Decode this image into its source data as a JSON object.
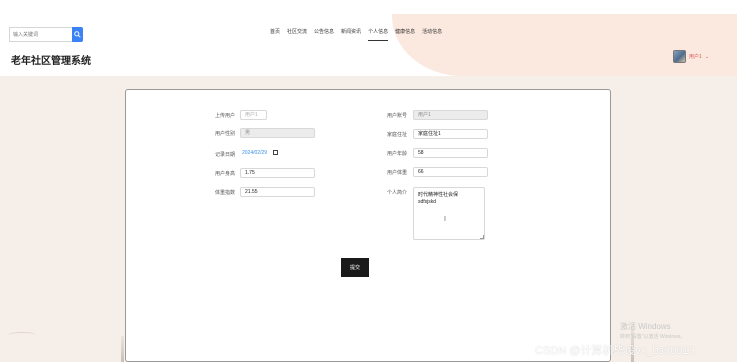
{
  "search": {
    "placeholder": "输入关键词"
  },
  "nav": {
    "items": [
      {
        "label": "首页"
      },
      {
        "label": "社区交流"
      },
      {
        "label": "公告信息"
      },
      {
        "label": "新闻资讯"
      },
      {
        "label": "个人信息"
      },
      {
        "label": "健康信息"
      },
      {
        "label": "活动信息"
      }
    ],
    "active_index": 4
  },
  "app": {
    "title": "老年社区管理系统"
  },
  "user": {
    "name": "用户1"
  },
  "form": {
    "upload_user": {
      "label": "上传用户",
      "placeholder": "用户1"
    },
    "account": {
      "label": "用户账号",
      "value": "用户1"
    },
    "gender": {
      "label": "用户性别",
      "value": "男"
    },
    "address": {
      "label": "家庭住址",
      "value": "家庭住址1"
    },
    "record_date": {
      "label": "记录日期",
      "value": "2024/02/29"
    },
    "age": {
      "label": "用户年龄",
      "value": "58"
    },
    "height": {
      "label": "用户身高",
      "value": "1.75"
    },
    "weight": {
      "label": "用户体重",
      "value": "66"
    },
    "bmi": {
      "label": "体重指数",
      "value": "21.55"
    },
    "intro": {
      "label": "个人简介",
      "lines": [
        "时代精神性社会保",
        "sdfsjskd"
      ]
    }
  },
  "submit_label": "提交",
  "watermark": {
    "windows_title": "激活 Windows",
    "windows_sub": "转到\"设置\"以激活 Windows。",
    "csdn": "CSDN @计算机毕设vx_bs30813"
  }
}
